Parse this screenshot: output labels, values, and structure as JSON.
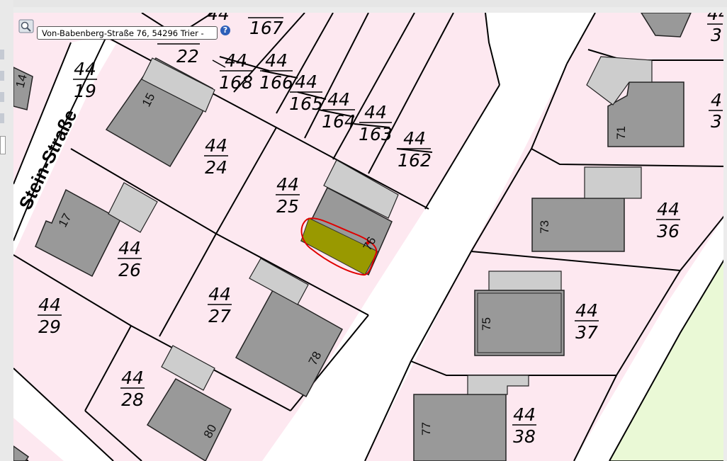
{
  "search": {
    "address": "Von-Babenberg-Straße 76, 54296 Trier -"
  },
  "help_icon": {
    "glyph": "?"
  },
  "street_name": "Stein-Straße",
  "colors": {
    "parcel_fill": "#fde8f0",
    "building_fill": "#999999",
    "garage_fill": "#cdcdcd",
    "road_fill": "#ffffff",
    "green_area": "#eaf9d6",
    "highlight_fill": "#999900",
    "highlight_outline": "#e00000"
  },
  "parcels": [
    {
      "top": "44",
      "bottom": "19"
    },
    {
      "top": "44",
      "bottom": "24"
    },
    {
      "top": "44",
      "bottom": "25"
    },
    {
      "top": "44",
      "bottom": "26"
    },
    {
      "top": "44",
      "bottom": "27"
    },
    {
      "top": "44",
      "bottom": "28"
    },
    {
      "top": "44",
      "bottom": "29"
    },
    {
      "top": "44",
      "bottom": "162"
    },
    {
      "top": "44",
      "bottom": "163"
    },
    {
      "top": "44",
      "bottom": "164"
    },
    {
      "top": "44",
      "bottom": "165"
    },
    {
      "top": "44",
      "bottom": "166"
    },
    {
      "top": "44",
      "bottom": "168"
    },
    {
      "top": "44",
      "bottom": "36"
    },
    {
      "top": "44",
      "bottom": "37"
    },
    {
      "top": "44",
      "bottom": "38"
    }
  ],
  "partial_labels": [
    "167",
    "22",
    "44",
    "44",
    "3",
    "4",
    "3"
  ],
  "house_numbers": [
    "15",
    "17",
    "76",
    "78",
    "80",
    "71",
    "73",
    "75",
    "77",
    "14"
  ]
}
